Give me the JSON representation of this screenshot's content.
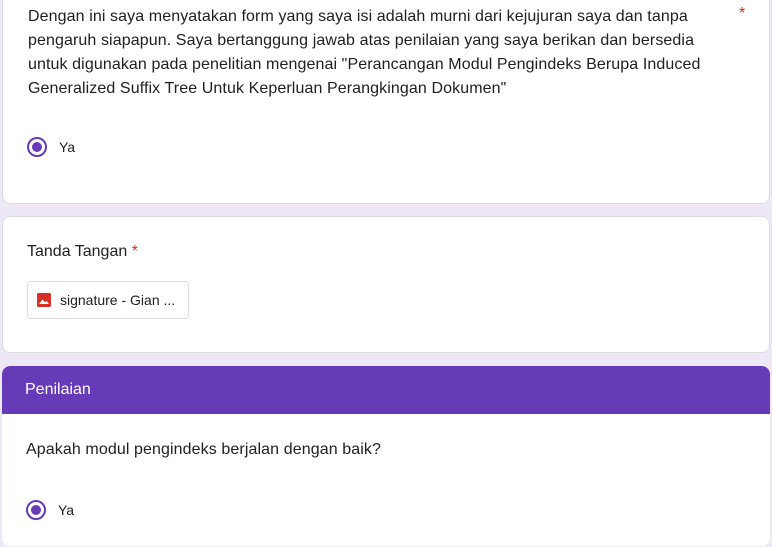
{
  "consent_question": {
    "text": "Dengan ini saya menyatakan form yang saya isi adalah murni dari kejujuran saya dan tanpa pengaruh siapapun. Saya bertanggung jawab atas penilaian yang saya berikan dan bersedia untuk digunakan pada penelitian mengenai \"Perancangan Modul Pengindeks Berupa Induced Generalized Suffix Tree Untuk Keperluan Perangkingan Dokumen\"",
    "required_mark": "*",
    "selected_option": "Ya"
  },
  "signature_question": {
    "label": "Tanda Tangan",
    "required_mark": "*",
    "file_name": "signature - Gian ..."
  },
  "section": {
    "title": "Penilaian"
  },
  "module_question": {
    "text": "Apakah modul pengindeks berjalan dengan baik?",
    "selected_option": "Ya"
  },
  "colors": {
    "accent": "#673ab7",
    "background": "#ede7f6",
    "required": "#d93025",
    "image_icon": "#d93025"
  },
  "icons": {
    "file_icon": "image-file-icon"
  }
}
